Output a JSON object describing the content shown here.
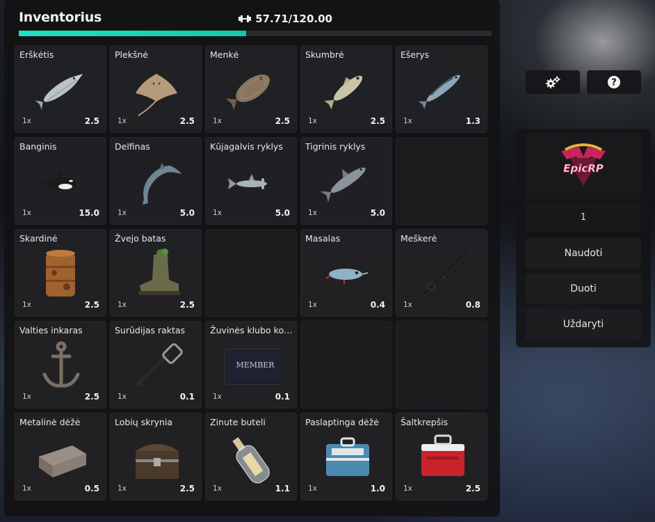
{
  "inventory": {
    "title": "Inventorius",
    "weight_text": "57.71/120.00",
    "weight_fraction": 0.481,
    "accent_color": "#1de2c2"
  },
  "slots": [
    {
      "name": "Erškėtis",
      "count": "1x",
      "weight": "2.5",
      "icon": "sturgeon-icon"
    },
    {
      "name": "Plekšnė",
      "count": "1x",
      "weight": "2.5",
      "icon": "stingray-icon"
    },
    {
      "name": "Menkė",
      "count": "1x",
      "weight": "2.5",
      "icon": "flounder-icon"
    },
    {
      "name": "Skumbrė",
      "count": "1x",
      "weight": "2.5",
      "icon": "fish-icon"
    },
    {
      "name": "Ešerys",
      "count": "1x",
      "weight": "1.3",
      "icon": "mackerel-icon"
    },
    {
      "name": "Banginis",
      "count": "1x",
      "weight": "15.0",
      "icon": "orca-icon"
    },
    {
      "name": "Delfinas",
      "count": "1x",
      "weight": "5.0",
      "icon": "dolphin-icon"
    },
    {
      "name": "Kūjagalvis ryklys",
      "count": "1x",
      "weight": "5.0",
      "icon": "hammerhead-icon"
    },
    {
      "name": "Tigrinis ryklys",
      "count": "1x",
      "weight": "5.0",
      "icon": "shark-icon"
    },
    {
      "name": "",
      "count": "",
      "weight": "",
      "icon": ""
    },
    {
      "name": "Skardinė",
      "count": "1x",
      "weight": "2.5",
      "icon": "rusty-can-icon"
    },
    {
      "name": "Žvejo batas",
      "count": "1x",
      "weight": "2.5",
      "icon": "old-boot-icon"
    },
    {
      "name": "",
      "count": "",
      "weight": "",
      "icon": ""
    },
    {
      "name": "Masalas",
      "count": "1x",
      "weight": "0.4",
      "icon": "lure-icon"
    },
    {
      "name": "Meškerė",
      "count": "1x",
      "weight": "0.8",
      "icon": "fishing-rod-icon"
    },
    {
      "name": "Valties inkaras",
      "count": "1x",
      "weight": "2.5",
      "icon": "anchor-icon"
    },
    {
      "name": "Surūdijas raktas",
      "count": "1x",
      "weight": "0.1",
      "icon": "rusty-key-icon"
    },
    {
      "name": "Žuvinės klubo kort...",
      "count": "1x",
      "weight": "0.1",
      "icon": "member-card-icon"
    },
    {
      "name": "",
      "count": "",
      "weight": "",
      "icon": ""
    },
    {
      "name": "",
      "count": "",
      "weight": "",
      "icon": ""
    },
    {
      "name": "Metalinė dėžė",
      "count": "1x",
      "weight": "0.5",
      "icon": "metal-box-icon"
    },
    {
      "name": "Lobių skrynia",
      "count": "1x",
      "weight": "2.5",
      "icon": "treasure-chest-icon"
    },
    {
      "name": "Zinute buteli",
      "count": "1x",
      "weight": "1.1",
      "icon": "message-bottle-icon"
    },
    {
      "name": "Paslaptinga dėžė",
      "count": "1x",
      "weight": "1.0",
      "icon": "tackle-box-icon"
    },
    {
      "name": "Šaltkrepšis",
      "count": "1x",
      "weight": "2.5",
      "icon": "cooler-icon"
    }
  ],
  "member_card_text": "MEMBER",
  "side": {
    "logo_text": "EpicRP",
    "quantity": "1",
    "use_label": "Naudoti",
    "give_label": "Duoti",
    "close_label": "Uždaryti"
  }
}
